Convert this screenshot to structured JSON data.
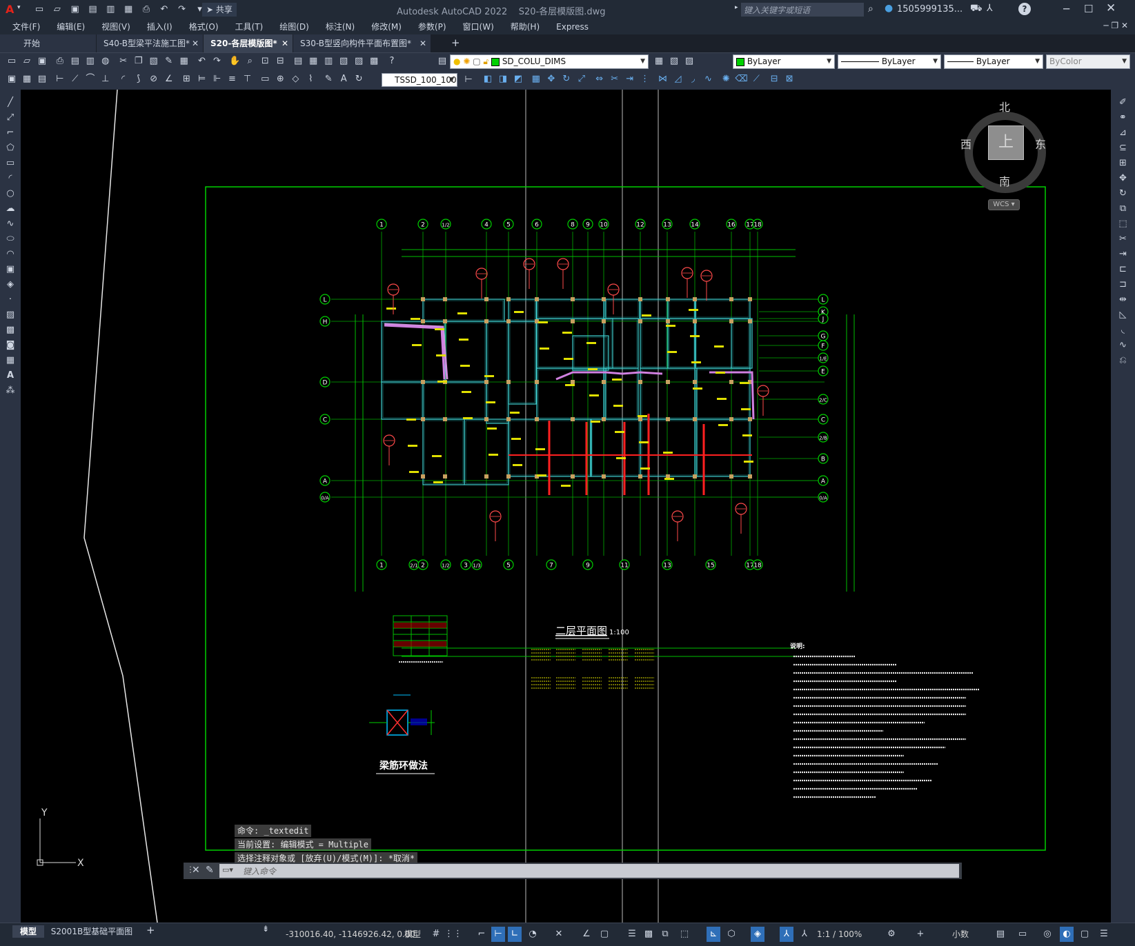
{
  "app": {
    "title": "Autodesk AutoCAD 2022",
    "document": "S20-各层模版图.dwg",
    "search_placeholder": "键入关键字或短语",
    "user": "1505999135...",
    "share_label": "共享"
  },
  "menu": [
    "文件(F)",
    "编辑(E)",
    "视图(V)",
    "插入(I)",
    "格式(O)",
    "工具(T)",
    "绘图(D)",
    "标注(N)",
    "修改(M)",
    "参数(P)",
    "窗口(W)",
    "帮助(H)",
    "Express"
  ],
  "tabs": [
    {
      "label": "开始"
    },
    {
      "label": "S40-B型梁平法施工图*"
    },
    {
      "label": "S20-各层模版图*"
    },
    {
      "label": "S30-B型竖向构件平面布置图*"
    }
  ],
  "toolbar": {
    "layer": "SD_COLU_DIMS",
    "color": "ByLayer",
    "linetype": "ByLayer",
    "lineweight": "ByLayer",
    "plotstyle": "ByColor",
    "dimstyle": "TSSD_100_100"
  },
  "viewcube": {
    "north": "北",
    "south": "南",
    "east": "东",
    "west": "西",
    "top": "上",
    "wcs": "WCS"
  },
  "drawing": {
    "plan_title": "二层平面图",
    "plan_scale": "1:100",
    "detail_title": "梁筋环做法",
    "top_axes": [
      "1",
      "2",
      "1/2",
      "4",
      "5",
      "6",
      "8",
      "9",
      "10",
      "12",
      "13",
      "14",
      "16",
      "17",
      "18"
    ],
    "bottom_axes": [
      "1",
      "2/1",
      "2",
      "1/2",
      "3",
      "1/3",
      "5",
      "7",
      "9",
      "11",
      "13",
      "15",
      "17",
      "18"
    ],
    "left_axes": [
      "L",
      "H",
      "D",
      "C",
      "A",
      "0/A"
    ],
    "right_axes": [
      "L",
      "K",
      "J",
      "G",
      "F",
      "1/E",
      "E",
      "2/C",
      "C",
      "2/B",
      "B",
      "A",
      "0/A"
    ],
    "notes_heading": "说明:"
  },
  "ucs": {
    "y": "Y",
    "x": "X"
  },
  "command": {
    "history": [
      "命令: _textedit",
      "当前设置: 编辑模式 = Multiple",
      "选择注释对象或 [放弃(U)/模式(M)]: *取消*"
    ],
    "placeholder": "键入命令"
  },
  "status": {
    "coords": "-310016.40, -1146926.42, 0.00",
    "space": "模型",
    "scale": "1:1 / 100%",
    "units": "小数"
  },
  "layout_tabs": [
    {
      "label": "模型"
    },
    {
      "label": "S2001B型基础平面图"
    }
  ],
  "colors": {
    "accent": "#2f6fb8",
    "grid_green": "#00c000",
    "column_cyan": "#3fd0d0",
    "callout_red": "#ff4a4a",
    "text_yellow": "#ffff00"
  }
}
